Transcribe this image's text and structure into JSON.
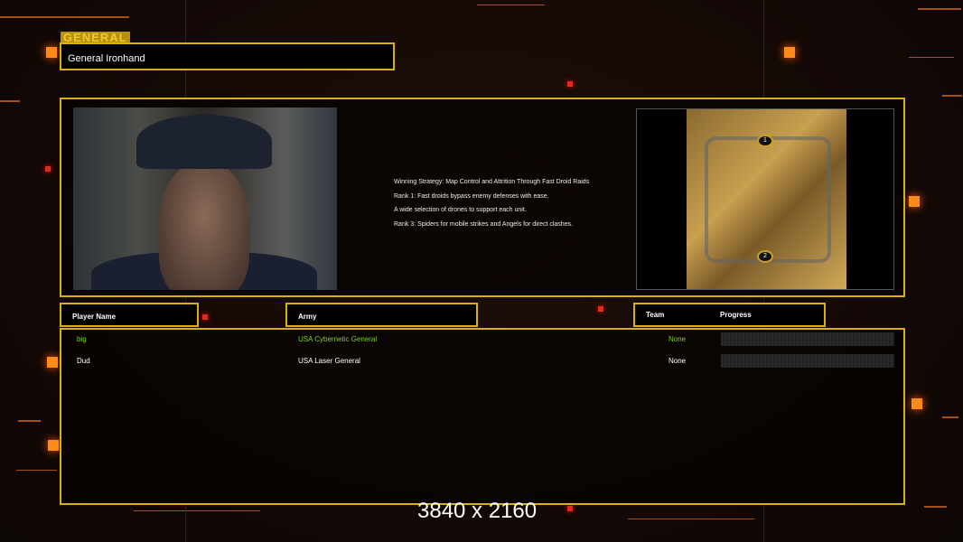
{
  "header": {
    "section_tag": "GENERAL",
    "general_name": "General Ironhand"
  },
  "strategy": [
    "Winning Strategy: Map Control and Attrition Through Fast Droid Raids",
    "Rank 1: Fast droids bypass enemy defenses with ease.",
    "A wide selection of drones to support each unit.",
    "Rank 3: Spiders for mobile strikes and Angels for direct clashes."
  ],
  "map": {
    "start_markers": [
      "1",
      "2"
    ]
  },
  "table": {
    "headers": {
      "player": "Player Name",
      "army": "Army",
      "team": "Team",
      "progress": "Progress"
    },
    "rows": [
      {
        "player": "big",
        "army": "USA Cybernetic General",
        "team": "None",
        "progress": 0,
        "color": "#7ed321"
      },
      {
        "player": "Dud",
        "army": "USA Laser General",
        "team": "None",
        "progress": 0,
        "color": "#ffffff"
      }
    ]
  },
  "watermark": "3840 x 2160"
}
